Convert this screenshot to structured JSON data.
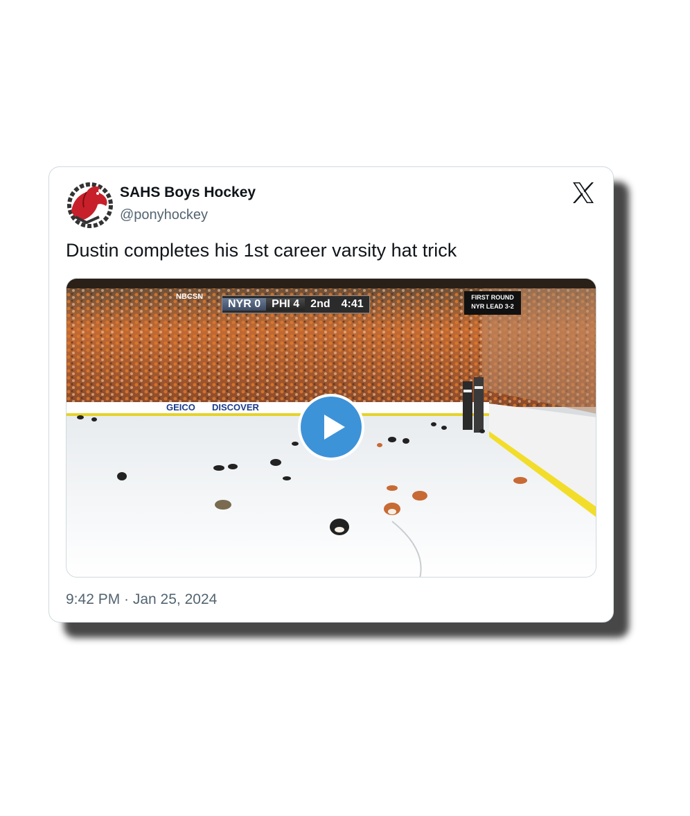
{
  "tweet": {
    "display_name": "SAHS Boys Hockey",
    "handle": "@ponyhockey",
    "text": "Dustin completes his 1st career varsity hat trick",
    "timestamp": "9:42 PM · Jan 25, 2024",
    "platform_icon": "x-logo-icon",
    "avatar_icon": "mustang-logo-icon"
  },
  "media": {
    "type": "video",
    "play_icon": "play-icon",
    "broadcast": {
      "network": "NBCSN",
      "away_team": "NYR",
      "away_score": "0",
      "home_team": "PHI",
      "home_score": "4",
      "period": "2nd",
      "clock": "4:41",
      "series_line1": "FIRST ROUND",
      "series_line2": "NYR LEAD 3-2",
      "ad1": "GEICO",
      "ad2": "DISCOVER"
    }
  },
  "colors": {
    "play_button": "#3d93d8",
    "name_text": "#0f1419",
    "secondary_text": "#536471",
    "card_border": "#cfd9de"
  }
}
